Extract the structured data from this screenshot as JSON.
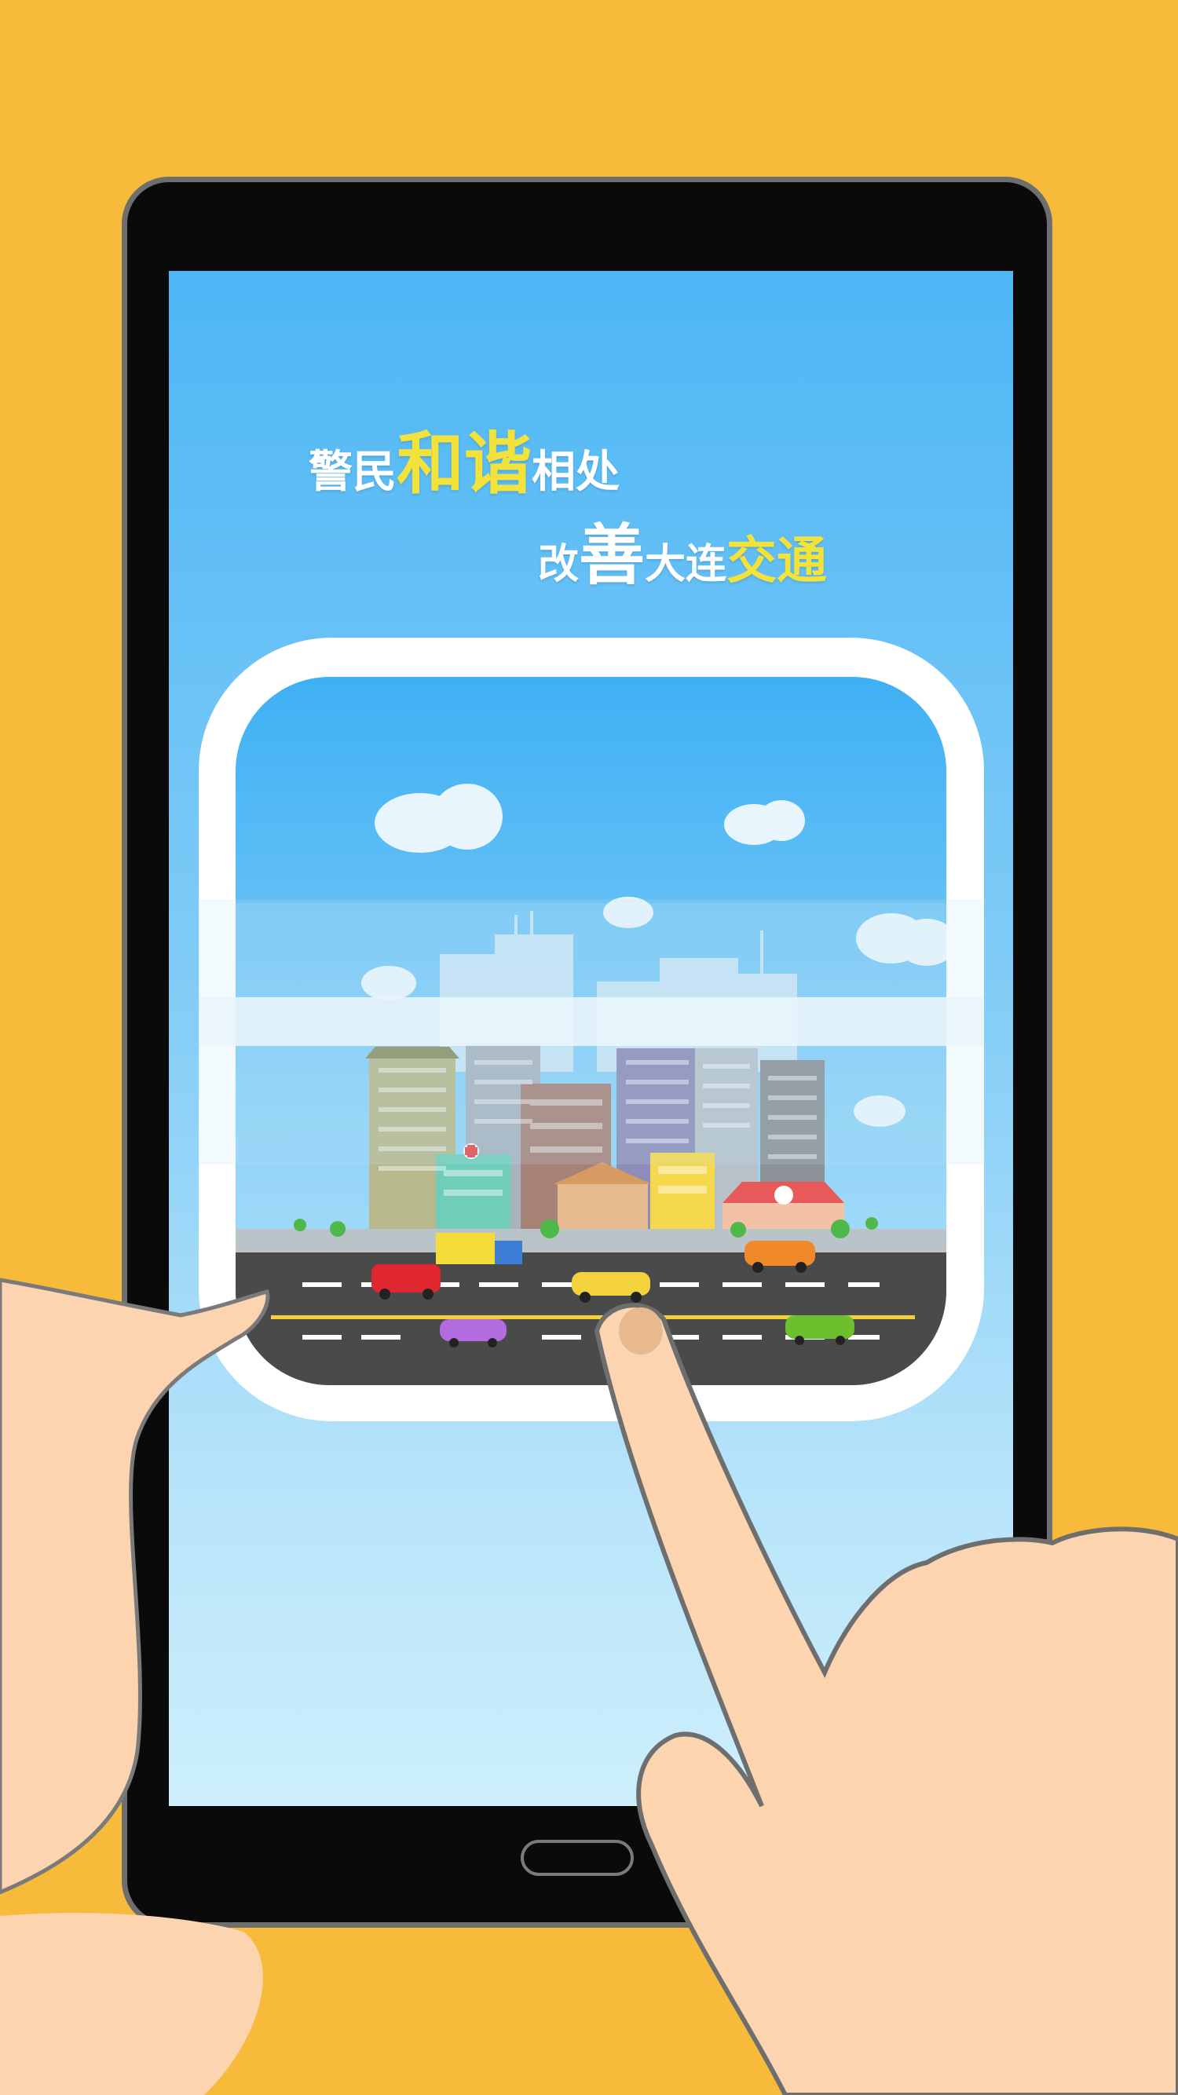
{
  "slogan": {
    "line1": {
      "part1": "警民",
      "part2": "和谐",
      "part3": "相处"
    },
    "line2": {
      "part1": "改",
      "part2": "善",
      "part3": "大连",
      "part4": "交通"
    }
  },
  "colors": {
    "background": "#F7BA3B",
    "phone": "#0a0a0a",
    "sky": "#4DB6F5",
    "highlight_text": "#F3E23A",
    "road": "#4a4a4a"
  },
  "icons": {
    "home": "home-button-icon",
    "hospital": "hospital-cross-icon"
  }
}
